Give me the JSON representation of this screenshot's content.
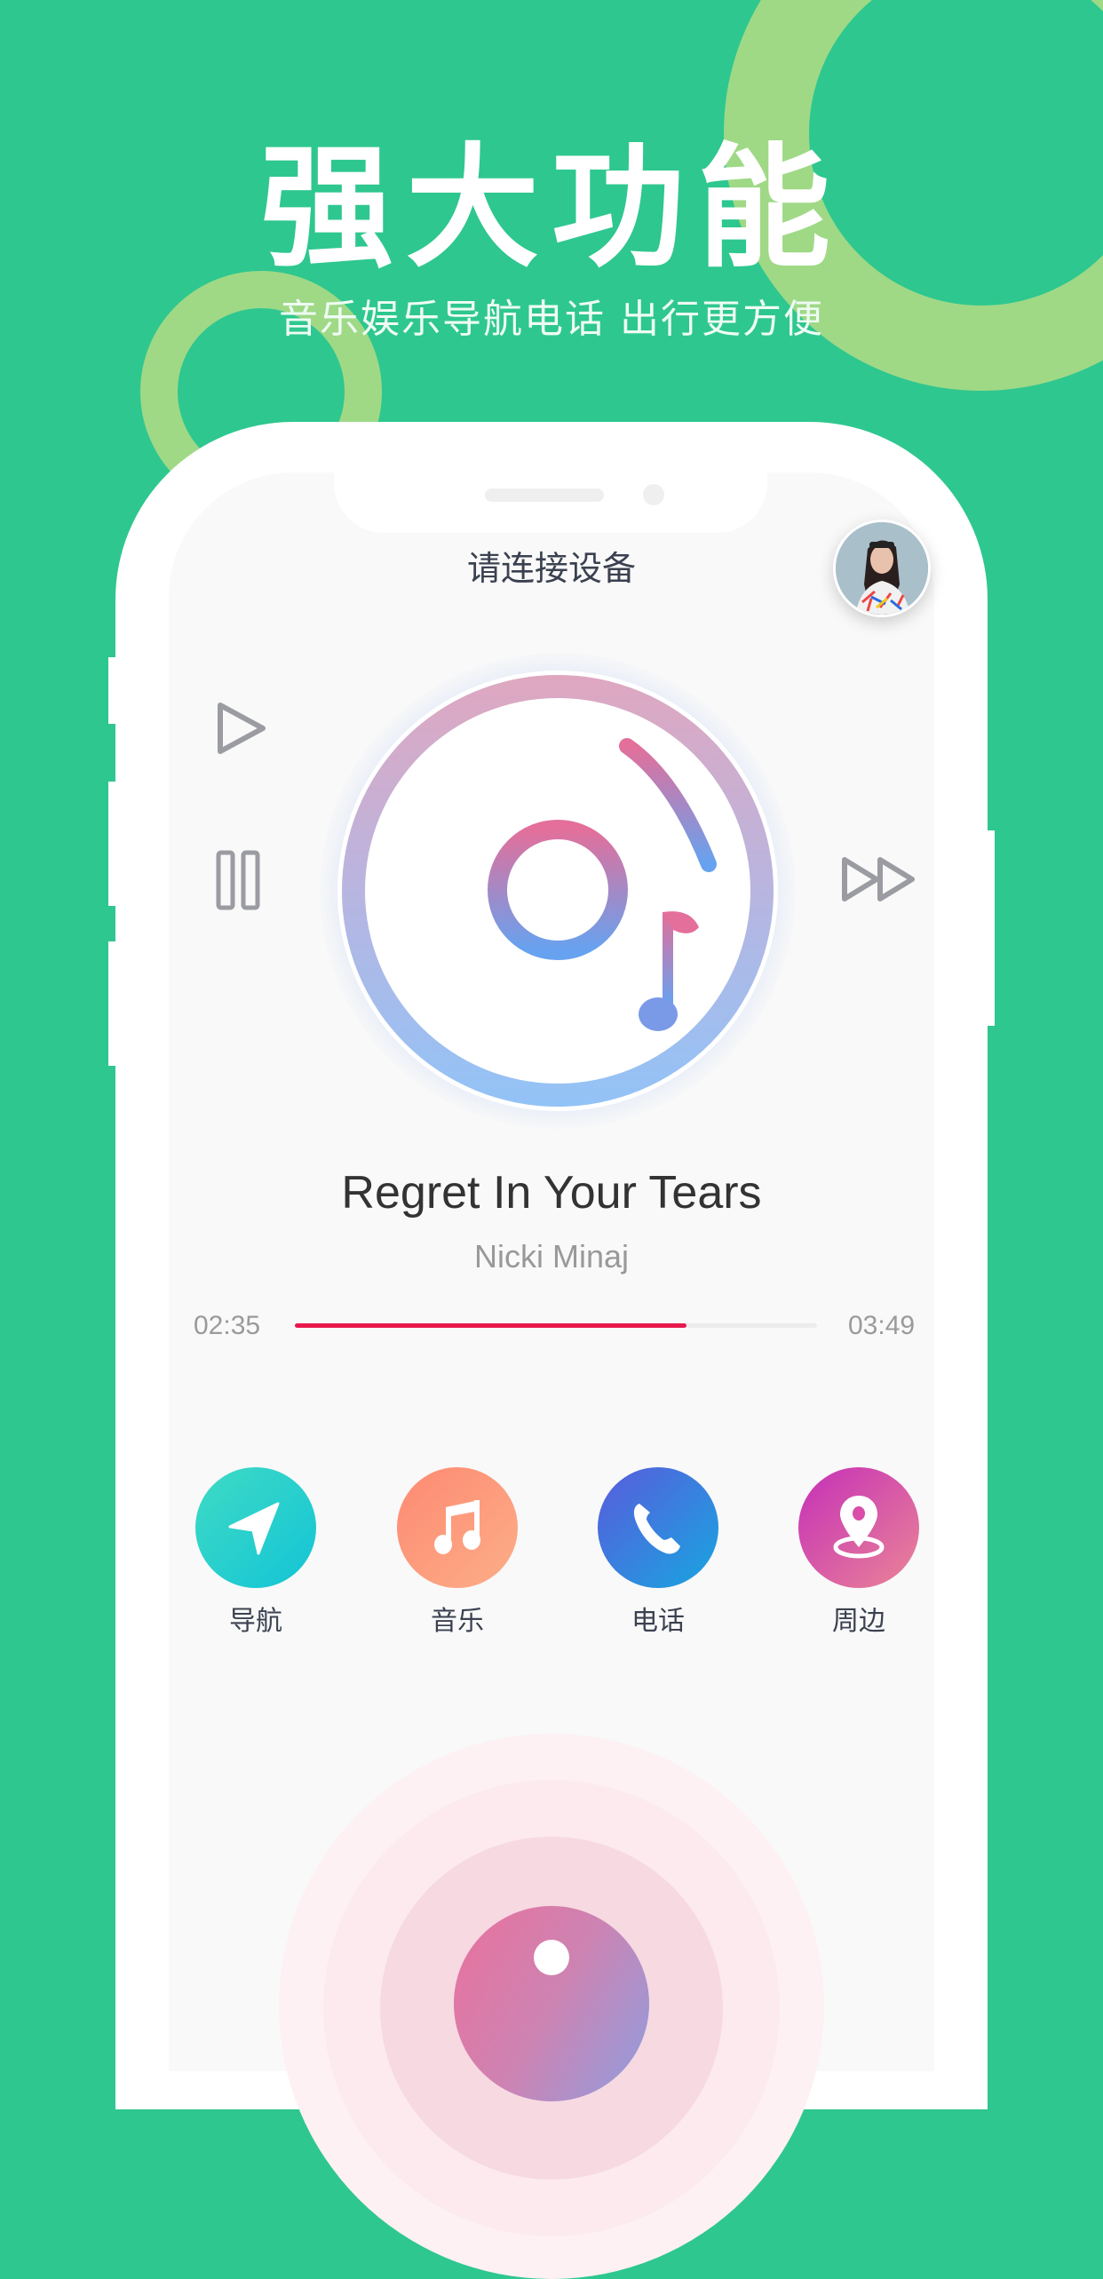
{
  "header": {
    "headline": "强大功能",
    "subline": "音乐娱乐导航电话  出行更方便"
  },
  "screen": {
    "status_text": "请连接设备",
    "avatar_icon": "user-avatar-photo"
  },
  "player": {
    "song_title": "Regret In Your Tears",
    "artist": "Nicki Minaj",
    "elapsed": "02:35",
    "duration": "03:49",
    "progress_fraction": 0.75,
    "controls": {
      "play_icon": "play-icon",
      "pause_icon": "pause-icon",
      "next_icon": "fast-forward-icon"
    },
    "accent_color": "#e8194d"
  },
  "features": [
    {
      "label": "导航",
      "icon": "navigation-arrow-icon",
      "colors": [
        "#3fdbc4",
        "#13c4d6"
      ]
    },
    {
      "label": "音乐",
      "icon": "music-note-icon",
      "colors": [
        "#fd8a72",
        "#fdae88"
      ]
    },
    {
      "label": "电话",
      "icon": "phone-icon",
      "colors": [
        "#5a5bdc",
        "#17a6e0"
      ]
    },
    {
      "label": "周边",
      "icon": "location-pin-icon",
      "colors": [
        "#c52fb8",
        "#ea8596"
      ]
    }
  ],
  "theme": {
    "background": "#2ec78f",
    "decor_ring": "#9fd986"
  }
}
